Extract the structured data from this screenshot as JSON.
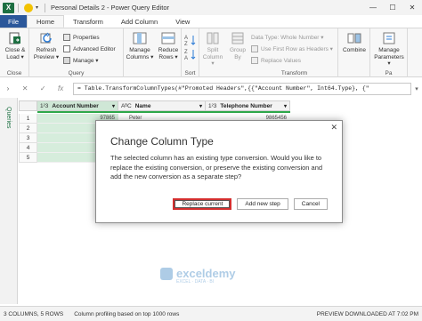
{
  "window": {
    "title": "Personal Details 2 - Power Query Editor",
    "logo": "X",
    "minimize": "—",
    "restore": "☐",
    "close": "✕"
  },
  "tabs": [
    {
      "label": "File"
    },
    {
      "label": "Home"
    },
    {
      "label": "Transform"
    },
    {
      "label": "Add Column"
    },
    {
      "label": "View"
    }
  ],
  "ribbon": {
    "close_group": {
      "label": "Close",
      "close_load": "Close &",
      "close_load2": "Load ▾"
    },
    "query_group": {
      "label": "Query",
      "refresh": "Refresh",
      "refresh2": "Preview ▾",
      "properties": "Properties",
      "advanced_editor": "Advanced Editor",
      "manage": "Manage ▾"
    },
    "manage_columns": {
      "line1": "Manage",
      "line2": "Columns ▾"
    },
    "reduce_rows": {
      "line1": "Reduce",
      "line2": "Rows ▾"
    },
    "sort": {
      "label": "Sort"
    },
    "split_column": {
      "line1": "Split",
      "line2": "Column ▾"
    },
    "group_by": {
      "line1": "Group",
      "line2": "By"
    },
    "transform_group": {
      "label": "Transform",
      "data_type": "Data Type: Whole Number ▾",
      "use_first_row": "Use First Row as Headers ▾",
      "replace_values": "Replace Values"
    },
    "combine": {
      "label": "Combine"
    },
    "manage_parameters": {
      "line1": "Manage",
      "line2": "Parameters ▾"
    },
    "parameters_label": "Pa"
  },
  "formula_bar": {
    "cancel": "✕",
    "confirm": "✓",
    "fx": "fx",
    "formula": "= Table.TransformColumnTypes(#\"Promoted Headers\",{{\"Account Number\", Int64.Type}, {\""
  },
  "queries_pane": {
    "label": "Queries"
  },
  "grid": {
    "columns": [
      {
        "type": "1²3",
        "name": "Account Number"
      },
      {
        "type": "AᴮC",
        "name": "Name"
      },
      {
        "type": "1²3",
        "name": "Telephone Number"
      }
    ],
    "rows": [
      {
        "num": "1",
        "account": "97865",
        "name": "Peter",
        "phone": "9865456"
      },
      {
        "num": "2",
        "account": "",
        "name": "",
        "phone": ""
      },
      {
        "num": "3",
        "account": "",
        "name": "",
        "phone": ""
      },
      {
        "num": "4",
        "account": "",
        "name": "",
        "phone": ""
      },
      {
        "num": "5",
        "account": "",
        "name": "",
        "phone": ""
      }
    ]
  },
  "dialog": {
    "title": "Change Column Type",
    "message": "The selected column has an existing type conversion. Would you like to replace the existing conversion, or preserve the existing conversion and add the new conversion as a separate step?",
    "replace_button": "Replace current",
    "add_button": "Add new step",
    "cancel_button": "Cancel",
    "close": "✕"
  },
  "watermark": {
    "brand": "exceldemy",
    "tagline": "EXCEL · DATA · BI"
  },
  "status_bar": {
    "columns_rows": "3 COLUMNS, 5 ROWS",
    "profiling": "Column profiling based on top 1000 rows",
    "preview": "PREVIEW DOWNLOADED AT 7:02 PM"
  },
  "colors": {
    "file_tab": "#2b579a",
    "excel_green": "#1d6f42",
    "highlight_red": "#d32f2f",
    "selected_col": "#d6eddc"
  }
}
